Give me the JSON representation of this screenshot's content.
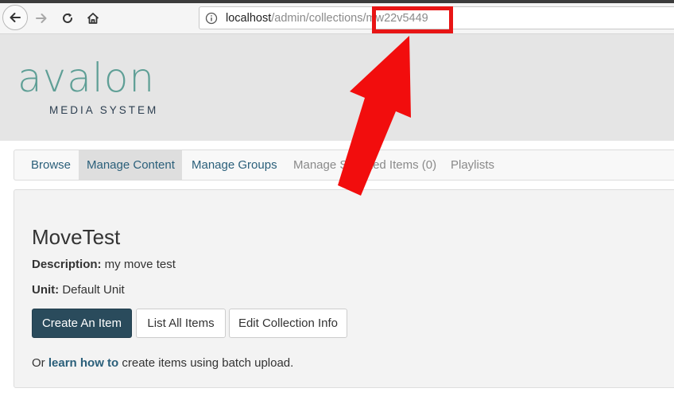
{
  "browser": {
    "url_host": "localhost",
    "url_path_pre": "/admin/collections",
    "url_path_id": "/mw22v5449",
    "icons": [
      "back-icon",
      "forward-icon",
      "reload-icon",
      "home-icon",
      "info-icon"
    ]
  },
  "logo": {
    "word": "avalon",
    "tagline": "MEDIA SYSTEM"
  },
  "nav": {
    "items": [
      {
        "label": "Browse"
      },
      {
        "label": "Manage Content"
      },
      {
        "label": "Manage Groups"
      },
      {
        "label": "Manage Selected Items (0)"
      },
      {
        "label": "Playlists"
      }
    ]
  },
  "collection": {
    "title": "MoveTest",
    "description_label": "Description:",
    "description_value": " my move test",
    "unit_label": "Unit:",
    "unit_value": " Default Unit",
    "buttons": {
      "create": "Create An Item",
      "list": "List All Items",
      "edit": "Edit Collection Info"
    },
    "batch_prefix": "Or ",
    "batch_link": "learn how to",
    "batch_suffix": " create items using batch upload."
  },
  "colors": {
    "highlight": "#e81515",
    "brand_teal": "#5f9f96",
    "primary_button": "#2a4b5c",
    "link": "#2a5f7a"
  }
}
